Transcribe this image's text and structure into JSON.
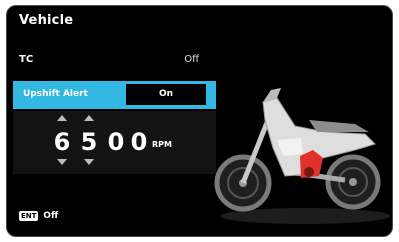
{
  "screen": {
    "title": "Vehicle"
  },
  "menu": {
    "traction_control": {
      "label": "TC",
      "value": "Off"
    },
    "upshift_alert": {
      "label": "Upshift Alert",
      "value": "On"
    }
  },
  "rpm_setting": {
    "digits": [
      "6",
      "5",
      "0",
      "0"
    ],
    "unit": "RPM"
  },
  "footer": {
    "ent_key": "ENT",
    "ent_value": "Off"
  },
  "colors": {
    "highlight": "#33b7e3",
    "background": "#000000",
    "bike_accent": "#e0312b"
  },
  "icons": [
    "arrow-up-icon",
    "arrow-down-icon",
    "motorcycle-illustration"
  ]
}
